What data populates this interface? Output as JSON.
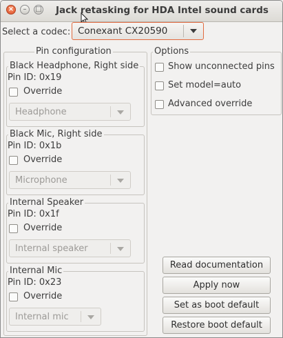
{
  "window": {
    "title": "Jack retasking for HDA Intel sound cards"
  },
  "codec": {
    "label": "Select a codec:",
    "selected": "Conexant CX20590"
  },
  "pin_config": {
    "title": "Pin configuration",
    "pins": [
      {
        "name": "Black Headphone, Right side",
        "pin_id": "Pin ID: 0x19",
        "override": "Override",
        "function": "Headphone"
      },
      {
        "name": "Black Mic, Right side",
        "pin_id": "Pin ID: 0x1b",
        "override": "Override",
        "function": "Microphone"
      },
      {
        "name": "Internal Speaker",
        "pin_id": "Pin ID: 0x1f",
        "override": "Override",
        "function": "Internal speaker"
      },
      {
        "name": "Internal Mic",
        "pin_id": "Pin ID: 0x23",
        "override": "Override",
        "function": "Internal mic"
      }
    ]
  },
  "options": {
    "title": "Options",
    "items": [
      {
        "label": "Show unconnected pins",
        "checked": false
      },
      {
        "label": "Set model=auto",
        "checked": false
      },
      {
        "label": "Advanced override",
        "checked": false
      }
    ]
  },
  "buttons": {
    "read_docs": "Read documentation",
    "apply_now": "Apply now",
    "set_boot_default": "Set as boot default",
    "restore_boot_default": "Restore boot default"
  },
  "icons": {
    "close": "close-icon",
    "minimize": "minimize-icon",
    "maximize": "maximize-icon",
    "dropdown": "chevron-down-icon"
  }
}
